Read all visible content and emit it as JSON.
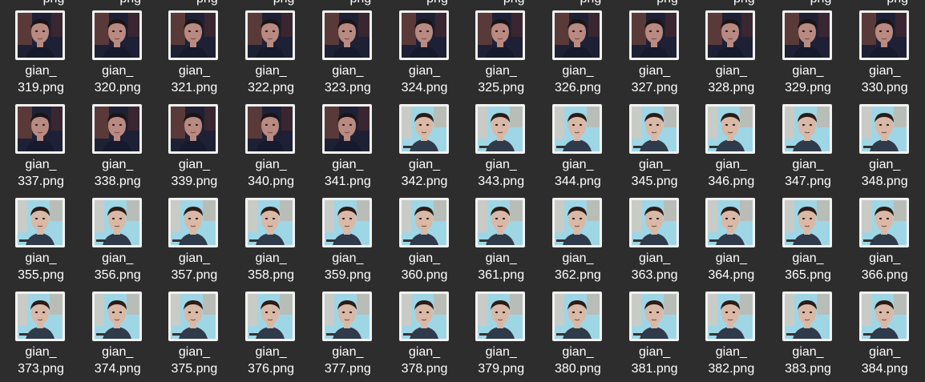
{
  "top_row_partial": [
    "png",
    "png",
    "png",
    "png",
    "png",
    "png",
    "png",
    "png",
    "png",
    "png",
    "png",
    "png"
  ],
  "files": [
    {
      "prefix": "gian_",
      "suffix": "319.png",
      "thumb": "dark"
    },
    {
      "prefix": "gian_",
      "suffix": "320.png",
      "thumb": "dark"
    },
    {
      "prefix": "gian_",
      "suffix": "321.png",
      "thumb": "dark"
    },
    {
      "prefix": "gian_",
      "suffix": "322.png",
      "thumb": "dark"
    },
    {
      "prefix": "gian_",
      "suffix": "323.png",
      "thumb": "dark"
    },
    {
      "prefix": "gian_",
      "suffix": "324.png",
      "thumb": "dark"
    },
    {
      "prefix": "gian_",
      "suffix": "325.png",
      "thumb": "dark"
    },
    {
      "prefix": "gian_",
      "suffix": "326.png",
      "thumb": "dark"
    },
    {
      "prefix": "gian_",
      "suffix": "327.png",
      "thumb": "dark"
    },
    {
      "prefix": "gian_",
      "suffix": "328.png",
      "thumb": "dark"
    },
    {
      "prefix": "gian_",
      "suffix": "329.png",
      "thumb": "dark"
    },
    {
      "prefix": "gian_",
      "suffix": "330.png",
      "thumb": "dark"
    },
    {
      "prefix": "gian_",
      "suffix": "337.png",
      "thumb": "dark"
    },
    {
      "prefix": "gian_",
      "suffix": "338.png",
      "thumb": "dark"
    },
    {
      "prefix": "gian_",
      "suffix": "339.png",
      "thumb": "dark"
    },
    {
      "prefix": "gian_",
      "suffix": "340.png",
      "thumb": "dark"
    },
    {
      "prefix": "gian_",
      "suffix": "341.png",
      "thumb": "dark"
    },
    {
      "prefix": "gian_",
      "suffix": "342.png",
      "thumb": "light"
    },
    {
      "prefix": "gian_",
      "suffix": "343.png",
      "thumb": "light"
    },
    {
      "prefix": "gian_",
      "suffix": "344.png",
      "thumb": "light"
    },
    {
      "prefix": "gian_",
      "suffix": "345.png",
      "thumb": "light"
    },
    {
      "prefix": "gian_",
      "suffix": "346.png",
      "thumb": "light"
    },
    {
      "prefix": "gian_",
      "suffix": "347.png",
      "thumb": "light"
    },
    {
      "prefix": "gian_",
      "suffix": "348.png",
      "thumb": "light"
    },
    {
      "prefix": "gian_",
      "suffix": "355.png",
      "thumb": "light"
    },
    {
      "prefix": "gian_",
      "suffix": "356.png",
      "thumb": "light"
    },
    {
      "prefix": "gian_",
      "suffix": "357.png",
      "thumb": "light"
    },
    {
      "prefix": "gian_",
      "suffix": "358.png",
      "thumb": "light"
    },
    {
      "prefix": "gian_",
      "suffix": "359.png",
      "thumb": "light"
    },
    {
      "prefix": "gian_",
      "suffix": "360.png",
      "thumb": "light"
    },
    {
      "prefix": "gian_",
      "suffix": "361.png",
      "thumb": "light"
    },
    {
      "prefix": "gian_",
      "suffix": "362.png",
      "thumb": "light"
    },
    {
      "prefix": "gian_",
      "suffix": "363.png",
      "thumb": "light"
    },
    {
      "prefix": "gian_",
      "suffix": "364.png",
      "thumb": "light"
    },
    {
      "prefix": "gian_",
      "suffix": "365.png",
      "thumb": "light"
    },
    {
      "prefix": "gian_",
      "suffix": "366.png",
      "thumb": "light"
    },
    {
      "prefix": "gian_",
      "suffix": "373.png",
      "thumb": "light"
    },
    {
      "prefix": "gian_",
      "suffix": "374.png",
      "thumb": "light"
    },
    {
      "prefix": "gian_",
      "suffix": "375.png",
      "thumb": "light"
    },
    {
      "prefix": "gian_",
      "suffix": "376.png",
      "thumb": "light"
    },
    {
      "prefix": "gian_",
      "suffix": "377.png",
      "thumb": "light"
    },
    {
      "prefix": "gian_",
      "suffix": "378.png",
      "thumb": "light"
    },
    {
      "prefix": "gian_",
      "suffix": "379.png",
      "thumb": "light"
    },
    {
      "prefix": "gian_",
      "suffix": "380.png",
      "thumb": "light"
    },
    {
      "prefix": "gian_",
      "suffix": "381.png",
      "thumb": "light"
    },
    {
      "prefix": "gian_",
      "suffix": "382.png",
      "thumb": "light"
    },
    {
      "prefix": "gian_",
      "suffix": "383.png",
      "thumb": "light"
    },
    {
      "prefix": "gian_",
      "suffix": "384.png",
      "thumb": "light"
    }
  ],
  "colors": {
    "background": "#2d2d2d",
    "label_text": "#ffffff",
    "thumb_border": "#f2f2f2"
  }
}
